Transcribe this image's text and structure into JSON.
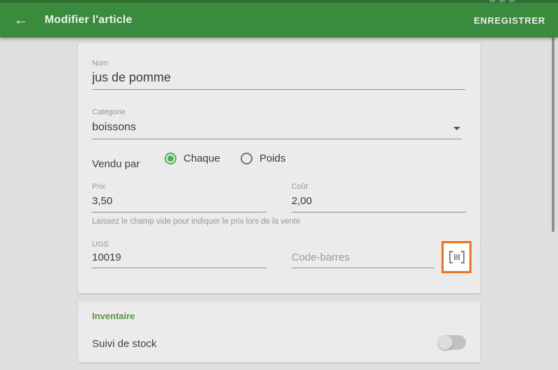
{
  "colors": {
    "statusbar_green": "#2d7031",
    "header_green": "#3a8b3e",
    "accent_green": "#4caf50",
    "section_title_green": "#5b9342",
    "highlight_orange": "#ee7420",
    "page_bg": "#dfdfdf",
    "card_bg": "#ebebeb"
  },
  "header": {
    "back_icon": "arrow-left",
    "title": "Modifier l'article",
    "save_label": "ENREGISTRER"
  },
  "form": {
    "name": {
      "label": "Nom",
      "value": "jus de pomme"
    },
    "category": {
      "label": "Catégorie",
      "value": "boissons",
      "icon": "chevron-down-icon"
    },
    "sold_by": {
      "label": "Vendu par",
      "options": [
        {
          "label": "Chaque",
          "selected": true
        },
        {
          "label": "Poids",
          "selected": false
        }
      ]
    },
    "price": {
      "label": "Prix",
      "value": "3,50"
    },
    "cost": {
      "label": "Coût",
      "value": "2,00"
    },
    "price_helper": "Laissez le champ vide pour indiquer le prix lors de la vente",
    "sku": {
      "label": "UGS",
      "value": "10019"
    },
    "barcode": {
      "placeholder": "Code-barres",
      "icon": "barcode-icon",
      "highlighted": true
    }
  },
  "inventory": {
    "title": "Inventaire",
    "track_stock": {
      "label": "Suivi de stock",
      "enabled": false
    }
  }
}
